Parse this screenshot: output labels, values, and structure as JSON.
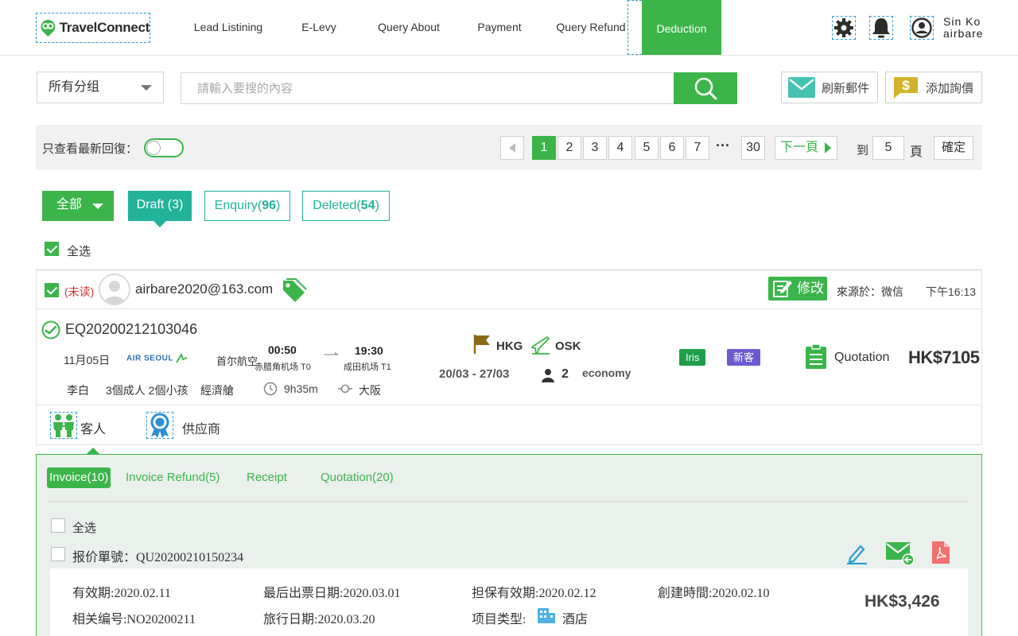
{
  "nav": {
    "logo_text": "TravelConnect",
    "items": [
      "Lead Listining",
      "E-Levy",
      "Query About",
      "Payment",
      "Query Refund",
      "Deduction"
    ],
    "active_item": "Deduction",
    "user_first": "Sin  Ko",
    "user_second": "airbare"
  },
  "search": {
    "group_select": "所有分组",
    "placeholder": "請輸入要搜的內容",
    "refresh_label": "刷新郵件",
    "add_quote_label": "添加詢價"
  },
  "filter": {
    "latest_only_label": "只查看最新回復：",
    "pages": [
      "1",
      "2",
      "3",
      "4",
      "5",
      "6",
      "7"
    ],
    "ellipsis": "···",
    "last_page": "30",
    "current_page": "1",
    "next_label": "下一頁",
    "goto_label": "到",
    "goto_value": "5",
    "page_unit": "頁",
    "confirm_label": "確定"
  },
  "tabs": {
    "all_label": "全部",
    "draft_label": "Draft",
    "draft_count": "(3)",
    "enquiry_label": "Enquiry(",
    "enquiry_count": "96",
    "deleted_label": "Deleted(",
    "deleted_count": "54",
    "close_paren": ")",
    "select_all": "全选"
  },
  "enquiry": {
    "unread": "(未读)",
    "email": "airbare2020@163.com",
    "edit_label": "修改",
    "source": "來源於：微信",
    "time": "下午16:13",
    "id": "EQ20200212103046",
    "date": "11月05日",
    "airline_logo": "AIR SEOUL",
    "airline": "首尔航空",
    "dep_time": "00:50",
    "dep_airport": "赤腊角机场 T0",
    "arr_time": "19:30",
    "arr_airport": "成田机场 T1",
    "passenger": "李白",
    "pax_detail": "3個成人 2個小孩",
    "cabin": "經濟艙",
    "duration": "9h35m",
    "stopover": "大阪",
    "origin": "HKG",
    "destination": "OSK",
    "date_range": "20/03 - 27/03",
    "pax_count": "2",
    "class": "economy",
    "agent_tag": "Iris",
    "client_tag": "新客",
    "status": "Quotation",
    "price": "HK$7105",
    "tab_customer": "客人",
    "tab_supplier": "供应商",
    "colors": {
      "agent_tag": "#1f9e4a",
      "client_tag": "#6b5bd2",
      "accent": "#3bb54a"
    }
  },
  "panel": {
    "tabs": [
      "Invoice(10)",
      "Invoice Refund(5)",
      "Receipt",
      "Quotation(20)"
    ],
    "active_tab": "Invoice(10)",
    "select_all": "全选",
    "quote_no": "报价單號：QU20200210150234",
    "validity": "有效期:2020.02.11",
    "last_ticket": "最后出票日期:2020.03.01",
    "guarantee": "担保有效期:2020.02.12",
    "created": "創建時間:2020.02.10",
    "ref_no": "相关编号:NO20200211",
    "travel_date": "旅行日期:2020.03.20",
    "item_type_label": "项目类型:",
    "item_type": "酒店",
    "amount": "HK$3,426"
  }
}
